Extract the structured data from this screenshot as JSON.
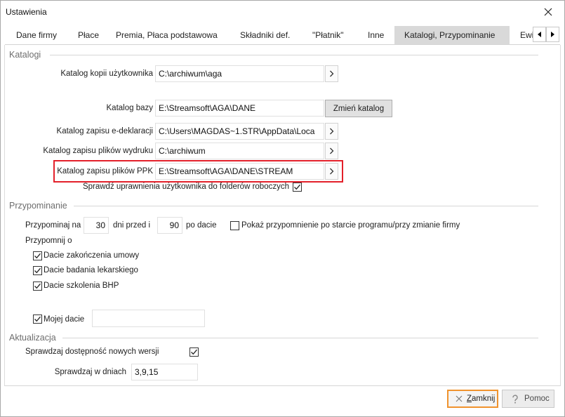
{
  "window": {
    "title": "Ustawienia",
    "close_icon": "close-icon"
  },
  "colors": {
    "selected_tab_bg": "#d9d9d9",
    "highlight_box": "#e3202a",
    "focus_border": "#f0932e",
    "section_title": "#6d6d6d"
  },
  "tabs": {
    "items": [
      {
        "label": "Dane firmy",
        "selected": false
      },
      {
        "label": "Płace",
        "selected": false
      },
      {
        "label": "Premia, Płaca podstawowa",
        "selected": false
      },
      {
        "label": "Składniki def.",
        "selected": false
      },
      {
        "label": "\"Płatnik\"",
        "selected": false
      },
      {
        "label": "Inne",
        "selected": false
      },
      {
        "label": "Katalogi, Przypominanie",
        "selected": true
      },
      {
        "label": "Ewi",
        "selected": false
      }
    ],
    "scroll_left_icon": "triangle-left-icon",
    "scroll_right_icon": "triangle-right-icon"
  },
  "katalogi": {
    "title": "Katalogi",
    "browse_icon": "chevron-right-icon",
    "rows": [
      {
        "label": "Katalog kopii użytkownika",
        "value": "C:\\archiwum\\aga"
      },
      {
        "label": "Katalog bazy",
        "value": "E:\\Streamsoft\\AGA\\DANE",
        "button": "Zmień katalog"
      },
      {
        "label": "Katalog zapisu e-deklaracji",
        "value": "C:\\Users\\MAGDAS~1.STR\\AppData\\Loca"
      },
      {
        "label": "Katalog zapisu plików wydruku",
        "value": "C:\\archiwum"
      },
      {
        "label": "Katalog zapisu plików PPK",
        "value": "E:\\Streamsoft\\AGA\\DANE\\STREAM",
        "highlighted": true
      }
    ],
    "check_permissions": {
      "label": "Sprawdź uprawnienia użytkownika do folderów roboczych",
      "checked": true
    }
  },
  "przypominanie": {
    "title": "Przypominanie",
    "remind_label": "Przypominaj na",
    "days_before": "30",
    "days_before_label": "dni przed i",
    "days_after": "90",
    "days_after_label": "po dacie",
    "show_on_start": {
      "label": "Pokaż przypomnienie po starcie programu/przy zmianie firmy",
      "checked": false
    },
    "remind_about_label": "Przypomnij o",
    "options": [
      {
        "label": "Dacie zakończenia umowy",
        "checked": true
      },
      {
        "label": "Dacie badania lekarskiego",
        "checked": true
      },
      {
        "label": "Dacie szkolenia BHP",
        "checked": true
      }
    ],
    "my_date": {
      "label": "Mojej dacie",
      "checked": true
    }
  },
  "aktualizacja": {
    "title": "Aktualizacja",
    "check_updates": {
      "label": "Sprawdzaj dostępność nowych wersji",
      "checked": true
    },
    "check_days_label": "Sprawdzaj w dniach",
    "check_days": "3,9,15"
  },
  "footer": {
    "close": {
      "label": "Zamknij",
      "icon": "close-x-icon",
      "focused": true
    },
    "help": {
      "label": "Pomoc",
      "icon": "help-icon"
    }
  }
}
